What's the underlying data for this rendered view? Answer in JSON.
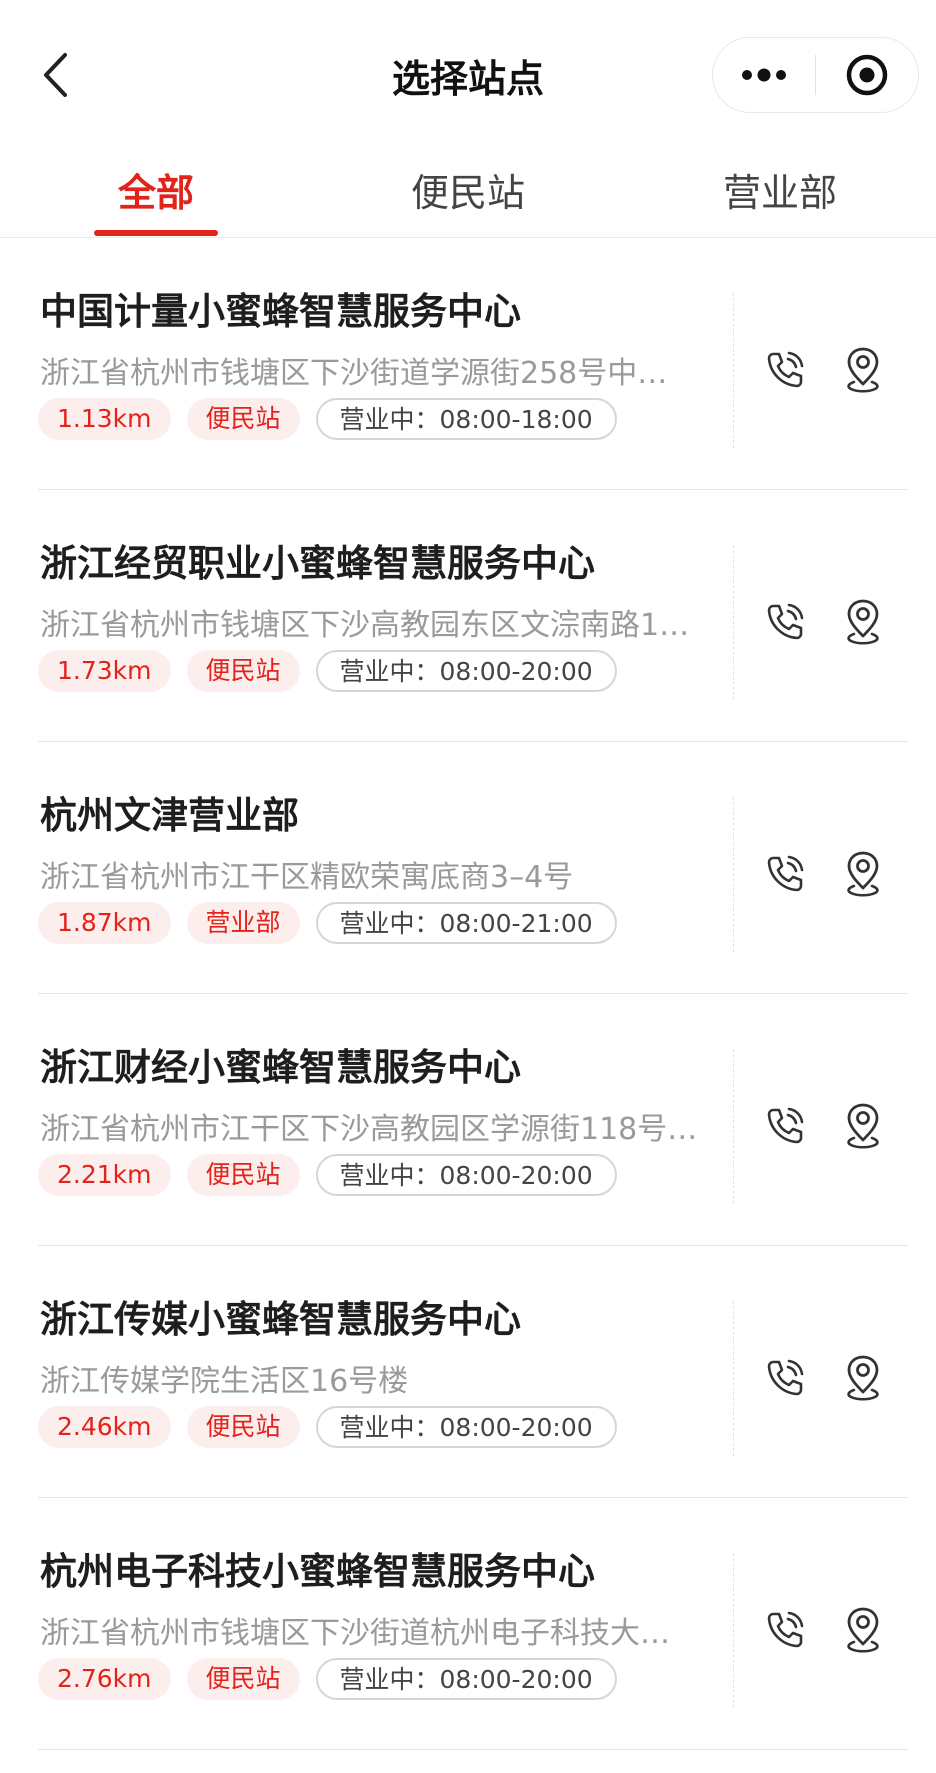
{
  "header": {
    "title": "选择站点"
  },
  "tabs": [
    {
      "label": "全部",
      "active": true
    },
    {
      "label": "便民站",
      "active": false
    },
    {
      "label": "营业部",
      "active": false
    }
  ],
  "colors": {
    "accent": "#e2231a",
    "tag_bg": "#fdeeee"
  },
  "icons": {
    "back": "chevron-left-icon",
    "more": "more-dots-icon",
    "target": "target-icon",
    "phone": "phone-icon",
    "location": "location-pin-icon"
  },
  "stations": [
    {
      "name": "中国计量小蜜蜂智慧服务中心",
      "address": "浙江省杭州市钱塘区下沙街道学源街258号中…",
      "distance": "1.13km",
      "type": "便民站",
      "hours": "营业中：08:00-18:00"
    },
    {
      "name": "浙江经贸职业小蜜蜂智慧服务中心",
      "address": "浙江省杭州市钱塘区下沙高教园东区文淙南路1…",
      "distance": "1.73km",
      "type": "便民站",
      "hours": "营业中：08:00-20:00"
    },
    {
      "name": "杭州文津营业部",
      "address": "浙江省杭州市江干区精欧荣寓底商3–4号",
      "distance": "1.87km",
      "type": "营业部",
      "hours": "营业中：08:00-21:00"
    },
    {
      "name": "浙江财经小蜜蜂智慧服务中心",
      "address": "浙江省杭州市江干区下沙高教园区学源街118号…",
      "distance": "2.21km",
      "type": "便民站",
      "hours": "营业中：08:00-20:00"
    },
    {
      "name": "浙江传媒小蜜蜂智慧服务中心",
      "address": "浙江传媒学院生活区16号楼",
      "distance": "2.46km",
      "type": "便民站",
      "hours": "营业中：08:00-20:00"
    },
    {
      "name": "杭州电子科技小蜜蜂智慧服务中心",
      "address": "浙江省杭州市钱塘区下沙街道杭州电子科技大…",
      "distance": "2.76km",
      "type": "便民站",
      "hours": "营业中：08:00-20:00"
    }
  ]
}
